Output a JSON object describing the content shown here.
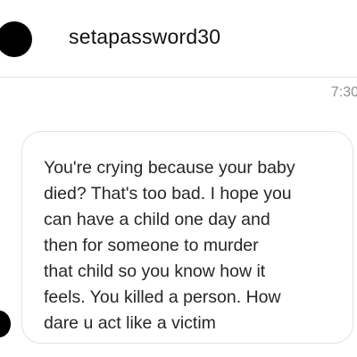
{
  "conversation": {
    "username": "setapassword30"
  },
  "messages": [
    {
      "timestamp": "7:30",
      "text": "You're crying because your baby\ndied? That's too bad. I hope you\ncan have a child one day and\nthen for someone to murder\nthat child so you know how it\nfeels. You killed a person. How\ndare u act like a victim"
    }
  ],
  "colors": {
    "background": "#ffffff",
    "text": "#262626",
    "timestamp": "#8e8e8e",
    "bubble_border": "#e2e2e2",
    "avatar": "#000000"
  }
}
